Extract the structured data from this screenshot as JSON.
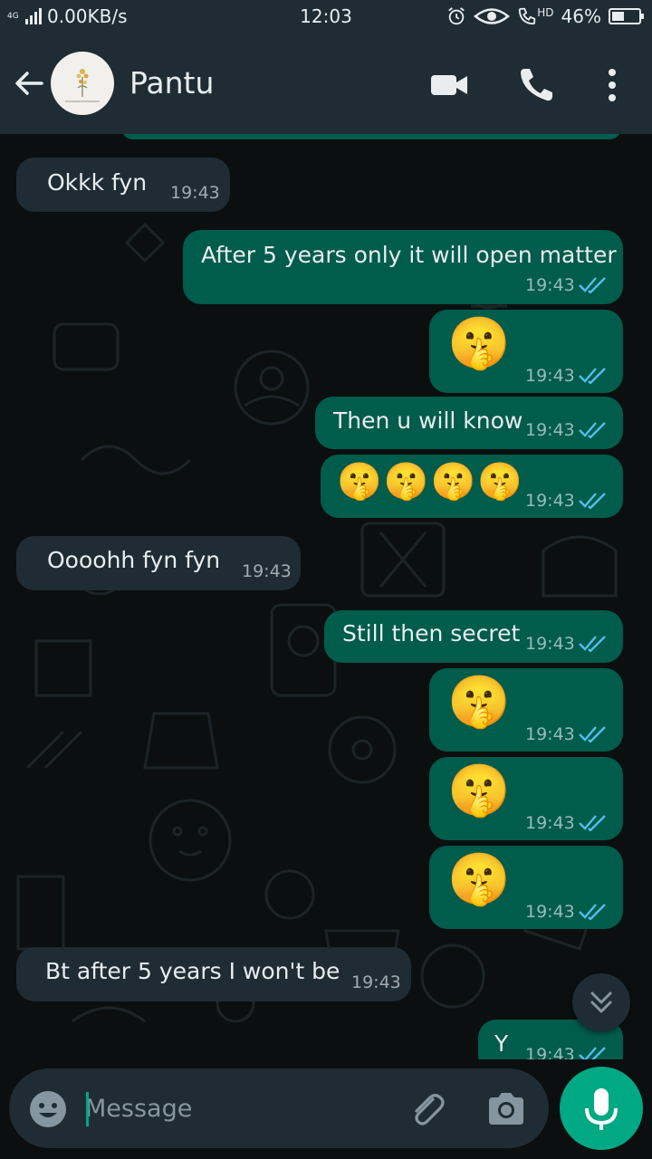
{
  "status_bar": {
    "network": "4G",
    "speed": "0.00KB/s",
    "time": "12:03",
    "hd": "HD",
    "battery": "46%",
    "battery_level": 0.46
  },
  "header": {
    "contact_name": "Pantu",
    "icons": [
      "back-arrow-icon",
      "video-call-icon",
      "voice-call-icon",
      "more-options-icon"
    ]
  },
  "messages": [
    {
      "dir": "in",
      "text": "Okkk fyn",
      "time": "19:43"
    },
    {
      "dir": "out",
      "text": "After 5 years only it will open matter",
      "time": "19:43",
      "read": true
    },
    {
      "dir": "out",
      "emoji": "🤫",
      "time": "19:43",
      "read": true
    },
    {
      "dir": "out",
      "text": "Then u will know",
      "time": "19:43",
      "read": true
    },
    {
      "dir": "out",
      "emoji": "🤫🤫🤫🤫",
      "time": "19:43",
      "read": true
    },
    {
      "dir": "in",
      "text": "Oooohh fyn fyn",
      "time": "19:43"
    },
    {
      "dir": "out",
      "text": "Still then secret",
      "time": "19:43",
      "read": true
    },
    {
      "dir": "out",
      "emoji": "🤫",
      "time": "19:43",
      "read": true
    },
    {
      "dir": "out",
      "emoji": "🤫",
      "time": "19:43",
      "read": true
    },
    {
      "dir": "out",
      "emoji": "🤫",
      "time": "19:43",
      "read": true
    },
    {
      "dir": "in",
      "text": "Bt after 5 years I won't be",
      "time": "19:43"
    },
    {
      "dir": "out",
      "text": "Y",
      "time": "19:43",
      "read": true
    }
  ],
  "composer": {
    "placeholder": "Message",
    "value": ""
  },
  "colors": {
    "header_bg": "#1f2c34",
    "chat_bg": "#0b0f10",
    "incoming_bubble": "#1f2c34",
    "outgoing_bubble": "#005c4b",
    "accent": "#00a884",
    "read_tick": "#53bdeb"
  }
}
